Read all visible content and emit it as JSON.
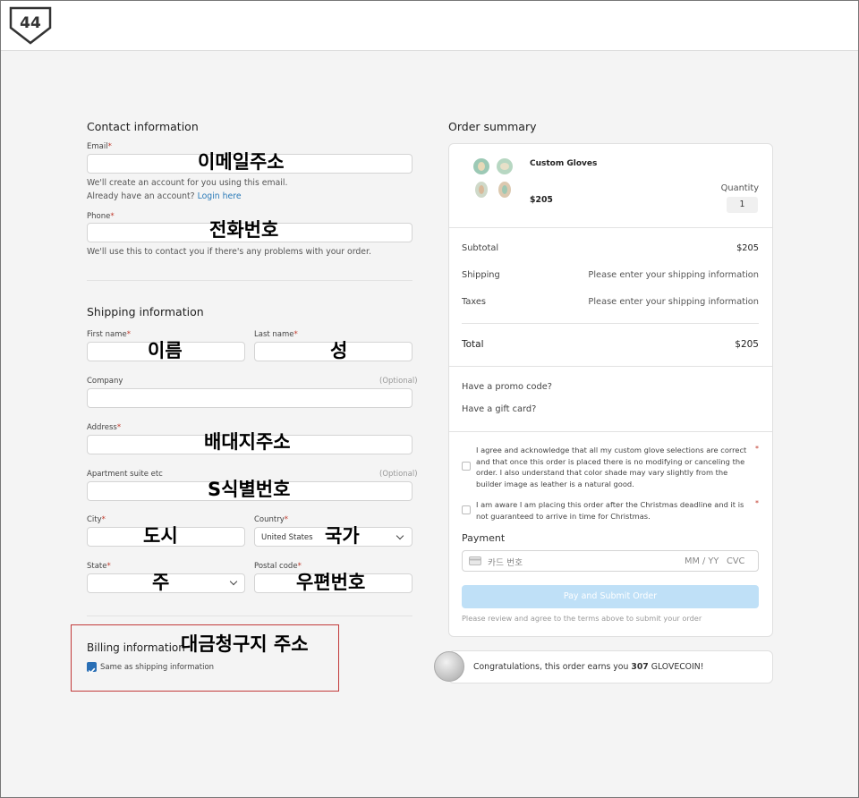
{
  "header": {
    "logo_text": "44"
  },
  "contact": {
    "title": "Contact information",
    "email_label": "Email",
    "email_overlay": "이메일주소",
    "email_help_1": "We'll create an account for you using this email.",
    "email_help_2": "Already have an account?",
    "login_link": "Login here",
    "phone_label": "Phone",
    "phone_overlay": "전화번호",
    "phone_help": "We'll use this to contact you if there's any problems with your order."
  },
  "shipping": {
    "title": "Shipping information",
    "first_name_label": "First name",
    "first_name_overlay": "이름",
    "last_name_label": "Last name",
    "last_name_overlay": "성",
    "company_label": "Company",
    "optional_text": "(Optional)",
    "address_label": "Address",
    "address_overlay": "배대지주소",
    "apartment_label": "Apartment suite etc",
    "apartment_overlay": "S식별번호",
    "city_label": "City",
    "city_overlay": "도시",
    "country_label": "Country",
    "country_value": "United States",
    "country_overlay": "국가",
    "state_label": "State",
    "state_overlay": "주",
    "postal_label": "Postal code",
    "postal_overlay": "우편번호"
  },
  "billing": {
    "title": "Billing information",
    "overlay": "대금청구지 주소",
    "same_as_shipping": "Same as shipping information",
    "same_checked": true
  },
  "summary": {
    "title": "Order summary",
    "product_name": "Custom Gloves",
    "product_price": "$205",
    "quantity_label": "Quantity",
    "quantity_value": "1",
    "subtotal_label": "Subtotal",
    "subtotal_value": "$205",
    "shipping_label": "Shipping",
    "shipping_value": "Please enter your shipping information",
    "taxes_label": "Taxes",
    "taxes_value": "Please enter your shipping information",
    "total_label": "Total",
    "total_value": "$205",
    "promo_link": "Have a promo code?",
    "gift_link": "Have a gift card?",
    "terms_1": "I agree and acknowledge that all my custom glove selections are correct and that once this order is placed there is no modifying or canceling the order. I also understand that color shade may vary slightly from the builder image as leather is a natural good.",
    "terms_2": "I am aware I am placing this order after the Christmas deadline and it is not guaranteed to arrive in time for Christmas.",
    "payment_title": "Payment",
    "card_placeholder": "카드 번호",
    "expiry_placeholder": "MM / YY",
    "cvc_placeholder": "CVC",
    "pay_button": "Pay and Submit Order",
    "pay_note": "Please review and agree to the terms above to submit your order"
  },
  "reward": {
    "text_before": "Congratulations, this order earns you",
    "amount": "307",
    "text_after": "GLOVECOIN!"
  },
  "colors": {
    "accent": "#2a7ab8",
    "pay_button_disabled": "#bfe0f7",
    "highlight_box": "#c23a3a",
    "checkbox_checked": "#2a6fb5"
  }
}
